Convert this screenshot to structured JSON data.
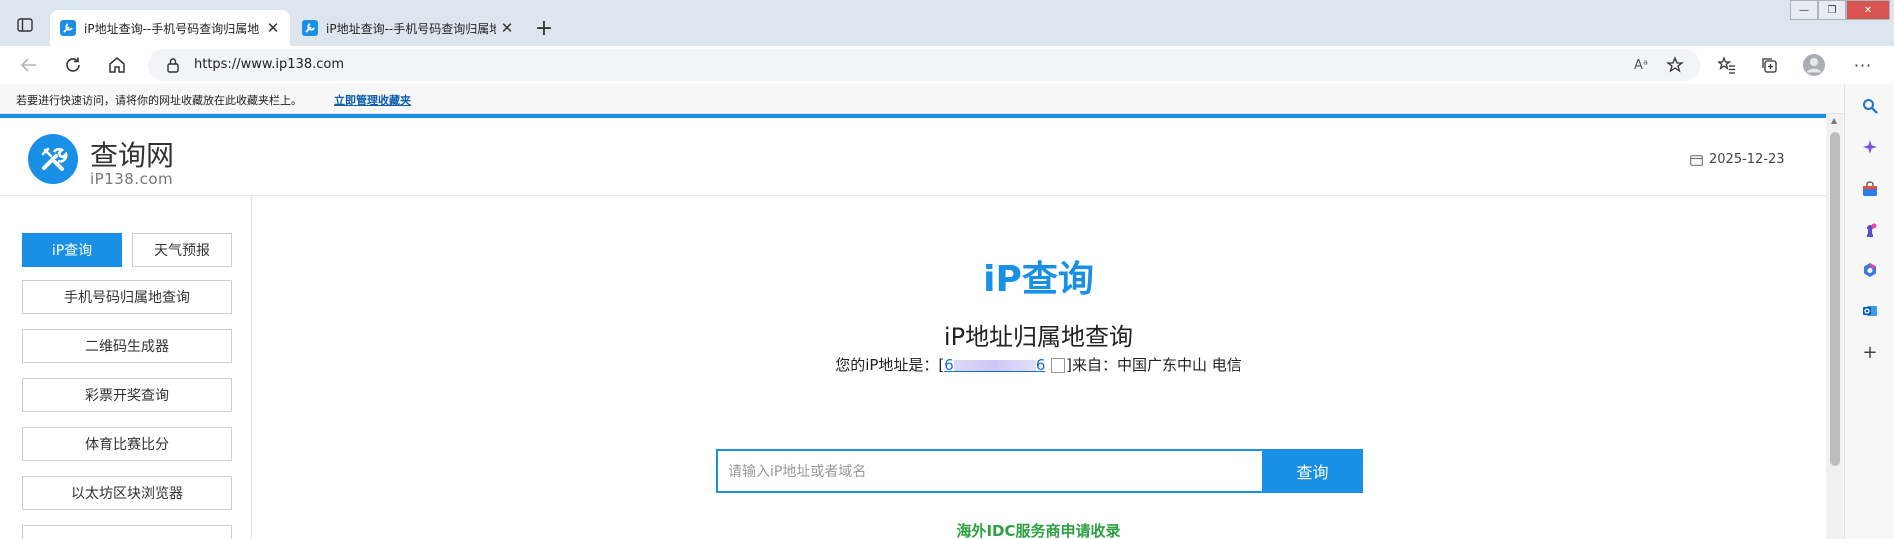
{
  "browser": {
    "tabs": [
      {
        "title": "iP地址查询--手机号码查询归属地",
        "active": true
      },
      {
        "title": "iP地址查询--手机号码查询归属地",
        "active": false
      }
    ],
    "new_tab_icon": "plus-icon",
    "window_controls": [
      "minimize-icon",
      "restore-icon",
      "close-icon"
    ],
    "address_url": "https://www.ip138.com",
    "toolbar_icons": [
      "back-icon",
      "refresh-icon",
      "home-icon",
      "lock-icon",
      "read-aloud-icon",
      "add-favorite-icon",
      "favorites-icon",
      "collections-icon",
      "profile-icon",
      "more-icon"
    ],
    "favorites_bar": {
      "hint": "若要进行快速访问，请将你的网址收藏放在此收藏夹栏上。",
      "manage_link": "立即管理收藏夹"
    },
    "sidebar_icons": [
      "search-icon",
      "copilot-icon",
      "shopping-icon",
      "games-icon",
      "m365-icon",
      "outlook-icon",
      "add-icon"
    ],
    "accent_color": "#1a8fe6"
  },
  "site": {
    "logo_title": "查询网",
    "logo_subtitle": "iP138.com",
    "date": "2025-12-23",
    "menu": [
      {
        "label": "iP查询",
        "active": true
      },
      {
        "label": "天气预报",
        "active": false
      },
      {
        "label": "手机号码归属地查询",
        "active": false
      },
      {
        "label": "二维码生成器",
        "active": false
      },
      {
        "label": "彩票开奖查询",
        "active": false
      },
      {
        "label": "体育比赛比分",
        "active": false
      },
      {
        "label": "以太坊区块浏览器",
        "active": false
      }
    ],
    "main": {
      "title": "iP查询",
      "subtitle": "iP地址归属地查询",
      "ip_prefix": "您的iP地址是：[",
      "ip_start": "6",
      "ip_end": "6",
      "ip_suffix": "]来自：中国广东中山 电信",
      "search_placeholder": "请输入iP地址或者域名",
      "search_button": "查询",
      "idc_link": "海外IDC服务商申请收录"
    }
  }
}
